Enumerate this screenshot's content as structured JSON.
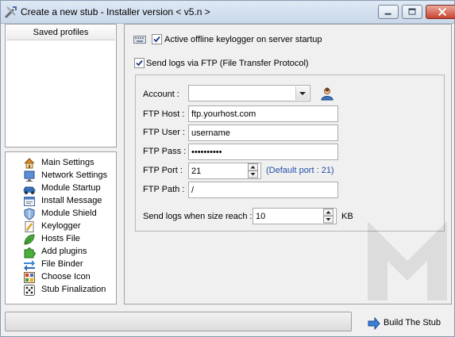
{
  "window": {
    "title": "Create a new stub - Installer version < v5.n >"
  },
  "saved_profiles": {
    "header": "Saved profiles"
  },
  "nav": {
    "items": [
      {
        "label": "Main Settings",
        "icon": "house-icon"
      },
      {
        "label": "Network Settings",
        "icon": "monitor-icon"
      },
      {
        "label": "Module Startup",
        "icon": "car-icon"
      },
      {
        "label": "Install Message",
        "icon": "message-icon"
      },
      {
        "label": "Module Shield",
        "icon": "shield-icon"
      },
      {
        "label": "Keylogger",
        "icon": "pencil-icon"
      },
      {
        "label": "Hosts File",
        "icon": "leaf-icon"
      },
      {
        "label": "Add plugins",
        "icon": "puzzle-icon"
      },
      {
        "label": "File Binder",
        "icon": "binder-arrows-icon"
      },
      {
        "label": "Choose Icon",
        "icon": "icon-image-icon"
      },
      {
        "label": "Stub Finalization",
        "icon": "dice-icon"
      }
    ]
  },
  "main": {
    "offline_keylogger": {
      "label": "Active offline keylogger on server startup",
      "checked": true
    },
    "send_logs_ftp": {
      "label": "Send logs via FTP (File Transfer Protocol)",
      "checked": true
    },
    "ftp": {
      "account_label": "Account :",
      "account_value": "",
      "host_label": "FTP Host :",
      "host_value": "ftp.yourhost.com",
      "user_label": "FTP User :",
      "user_value": "username",
      "pass_label": "FTP Pass :",
      "pass_value": "••••••••••",
      "port_label": "FTP Port :",
      "port_value": "21",
      "port_hint": "(Default port : 21)",
      "path_label": "FTP Path :",
      "path_value": "/",
      "size_label": "Send logs when size reach :",
      "size_value": "10",
      "size_unit": "KB"
    }
  },
  "footer": {
    "build_label": "Build The Stub"
  },
  "colors": {
    "accent_link": "#1f4ea8",
    "title_bg": "#c9d8ea",
    "close_red": "#c8442f"
  }
}
